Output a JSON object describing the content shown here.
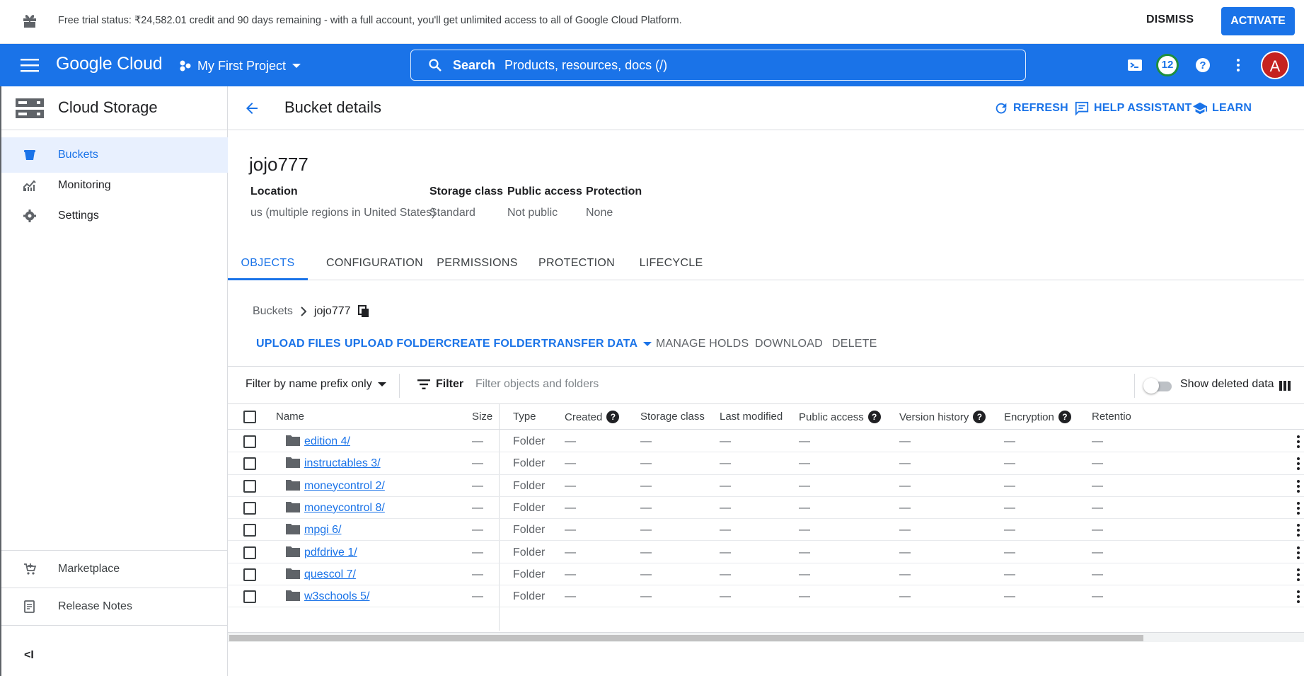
{
  "trial": {
    "message": "Free trial status: ₹24,582.01 credit and 90 days remaining - with a full account, you'll get unlimited access to all of Google Cloud Platform.",
    "dismiss": "DISMISS",
    "activate": "ACTIVATE"
  },
  "appbar": {
    "logo": "Google Cloud",
    "project": "My First Project",
    "search_label": "Search",
    "search_placeholder": "Products, resources, docs (/)",
    "notifications_count": "12",
    "avatar_letter": "A"
  },
  "sidebar": {
    "product": "Cloud Storage",
    "items": [
      {
        "label": "Buckets",
        "icon": "bucket-icon"
      },
      {
        "label": "Monitoring",
        "icon": "monitoring-icon"
      },
      {
        "label": "Settings",
        "icon": "gear-icon"
      }
    ],
    "bottom_items": [
      {
        "label": "Marketplace",
        "icon": "cart-icon"
      },
      {
        "label": "Release Notes",
        "icon": "notes-icon"
      }
    ],
    "collapse": "<I"
  },
  "header": {
    "title": "Bucket details",
    "refresh": "REFRESH",
    "help_assistant": "HELP ASSISTANT",
    "learn": "LEARN"
  },
  "bucket": {
    "name": "jojo777",
    "meta": [
      {
        "key": "Location",
        "value": "us (multiple regions in United States)"
      },
      {
        "key": "Storage class",
        "value": "Standard"
      },
      {
        "key": "Public access",
        "value": "Not public"
      },
      {
        "key": "Protection",
        "value": "None"
      }
    ]
  },
  "tabs": [
    "OBJECTS",
    "CONFIGURATION",
    "PERMISSIONS",
    "PROTECTION",
    "LIFECYCLE"
  ],
  "breadcrumb": {
    "root": "Buckets",
    "current": "jojo777"
  },
  "actions": {
    "upload_files": "UPLOAD FILES",
    "upload_folder": "UPLOAD FOLDER",
    "create_folder": "CREATE FOLDER",
    "transfer_data": "TRANSFER DATA",
    "manage_holds": "MANAGE HOLDS",
    "download": "DOWNLOAD",
    "delete": "DELETE"
  },
  "filter": {
    "prefix": "Filter by name prefix only",
    "label": "Filter",
    "placeholder": "Filter objects and folders",
    "show_deleted": "Show deleted data"
  },
  "columns": [
    "Name",
    "Size",
    "Type",
    "Created",
    "Storage class",
    "Last modified",
    "Public access",
    "Version history",
    "Encryption",
    "Retentio"
  ],
  "rows": [
    {
      "name": "edition 4/",
      "size": "—",
      "type": "Folder",
      "created": "—",
      "storage": "—",
      "modified": "—",
      "public": "—",
      "version": "—",
      "encryption": "—",
      "retention": "—"
    },
    {
      "name": "instructables 3/",
      "size": "—",
      "type": "Folder",
      "created": "—",
      "storage": "—",
      "modified": "—",
      "public": "—",
      "version": "—",
      "encryption": "—",
      "retention": "—"
    },
    {
      "name": "moneycontrol 2/",
      "size": "—",
      "type": "Folder",
      "created": "—",
      "storage": "—",
      "modified": "—",
      "public": "—",
      "version": "—",
      "encryption": "—",
      "retention": "—"
    },
    {
      "name": "moneycontrol 8/",
      "size": "—",
      "type": "Folder",
      "created": "—",
      "storage": "—",
      "modified": "—",
      "public": "—",
      "version": "—",
      "encryption": "—",
      "retention": "—"
    },
    {
      "name": "mpgi 6/",
      "size": "—",
      "type": "Folder",
      "created": "—",
      "storage": "—",
      "modified": "—",
      "public": "—",
      "version": "—",
      "encryption": "—",
      "retention": "—"
    },
    {
      "name": "pdfdrive 1/",
      "size": "—",
      "type": "Folder",
      "created": "—",
      "storage": "—",
      "modified": "—",
      "public": "—",
      "version": "—",
      "encryption": "—",
      "retention": "—"
    },
    {
      "name": "quescol 7/",
      "size": "—",
      "type": "Folder",
      "created": "—",
      "storage": "—",
      "modified": "—",
      "public": "—",
      "version": "—",
      "encryption": "—",
      "retention": "—"
    },
    {
      "name": "w3schools 5/",
      "size": "—",
      "type": "Folder",
      "created": "—",
      "storage": "—",
      "modified": "—",
      "public": "—",
      "version": "—",
      "encryption": "—",
      "retention": "—"
    }
  ],
  "colors": {
    "accent": "#1a73e8",
    "active_bg": "#e8f0fe"
  }
}
